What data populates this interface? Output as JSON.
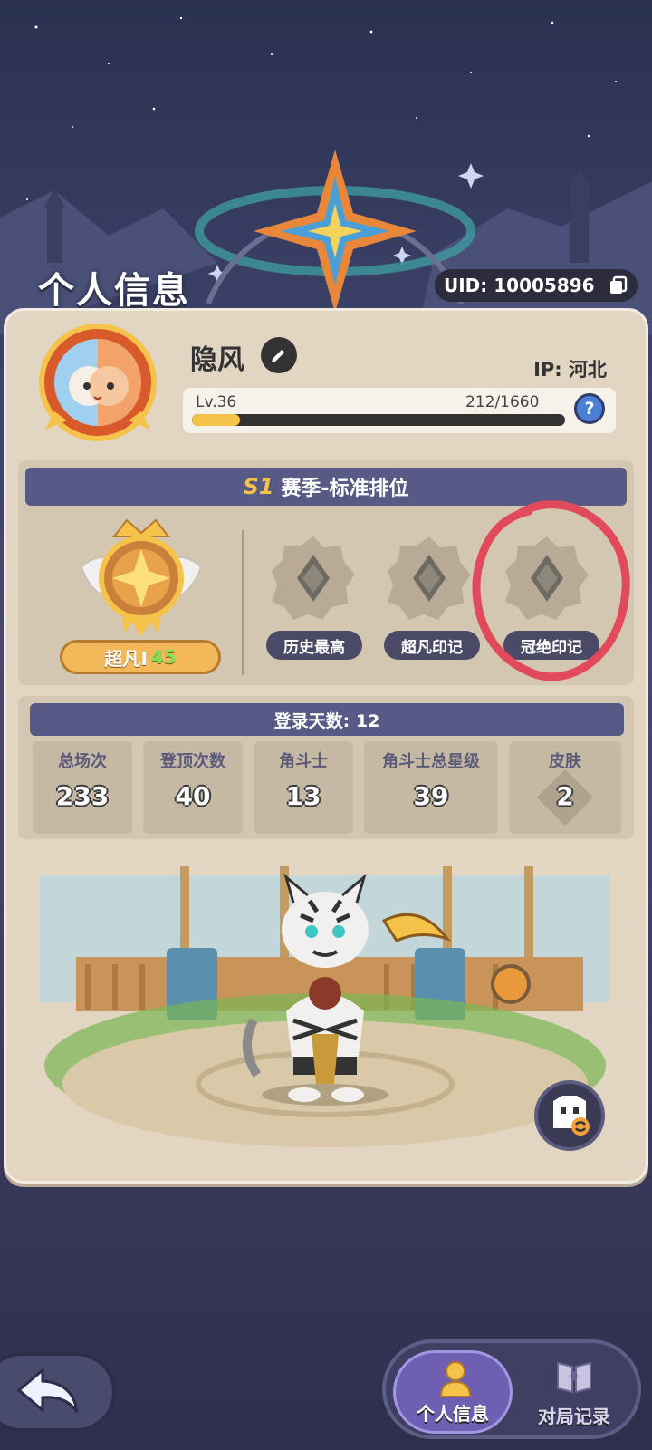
{
  "header": {
    "title": "个人信息",
    "uid_label": "UID: 10005896"
  },
  "profile": {
    "name": "隐风",
    "ip": "IP: 河北",
    "level": "Lv.36",
    "xp": "212/1660",
    "xp_progress": 0.128,
    "help_label": "?"
  },
  "season": {
    "tag": "S1",
    "title": "赛季-标准排位",
    "rank_name": "超凡I",
    "rank_stars": "45",
    "marks": [
      {
        "label": "历史最高",
        "icon": "empty-rank-icon"
      },
      {
        "label": "超凡印记",
        "icon": "empty-rank-icon"
      },
      {
        "label": "冠绝印记",
        "icon": "empty-rank-icon"
      }
    ]
  },
  "stats": {
    "login_days": "登录天数: 12",
    "items": [
      {
        "label": "总场次",
        "value": "233"
      },
      {
        "label": "登顶次数",
        "value": "40"
      },
      {
        "label": "角斗士",
        "value": "13"
      },
      {
        "label": "角斗士总星级",
        "value": "39"
      },
      {
        "label": "皮肤",
        "value": "2"
      }
    ]
  },
  "nav": {
    "tabs": [
      {
        "label": "个人信息",
        "icon": "person-icon",
        "active": true
      },
      {
        "label": "对局记录",
        "icon": "book-icon",
        "active": false
      }
    ]
  },
  "colors": {
    "accent_gold": "#f5c24a",
    "panel_bar": "#565a84",
    "card_bg": "#e2d6c2",
    "annotation_red": "#e04a5a"
  }
}
